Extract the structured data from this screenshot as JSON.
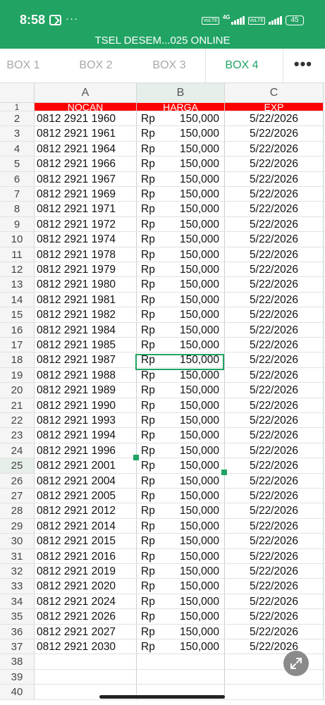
{
  "status_bar": {
    "time": "8:58",
    "more": "···",
    "sig1_tag": "VoLTE",
    "sig_4g": "4G",
    "sig2_tag": "VoLTE",
    "battery": "45"
  },
  "document": {
    "title": "TSEL DESEM...025 ONLINE"
  },
  "tabs": [
    {
      "label": "BOX 1",
      "active": false
    },
    {
      "label": "BOX 2",
      "active": false
    },
    {
      "label": "BOX 3",
      "active": false
    },
    {
      "label": "BOX 4",
      "active": true
    }
  ],
  "tabs_more": "•••",
  "columns": [
    "A",
    "B",
    "C"
  ],
  "header_row": {
    "num": "1",
    "a": "NOCAN",
    "b": "HARGA",
    "c": "EXP"
  },
  "rows": [
    {
      "num": "2",
      "nocan": "0812 2921 1960",
      "currency": "Rp",
      "price": "150,000",
      "exp": "5/22/2026"
    },
    {
      "num": "3",
      "nocan": "0812 2921 1961",
      "currency": "Rp",
      "price": "150,000",
      "exp": "5/22/2026"
    },
    {
      "num": "4",
      "nocan": "0812 2921 1964",
      "currency": "Rp",
      "price": "150,000",
      "exp": "5/22/2026"
    },
    {
      "num": "5",
      "nocan": "0812 2921 1966",
      "currency": "Rp",
      "price": "150,000",
      "exp": "5/22/2026"
    },
    {
      "num": "6",
      "nocan": "0812 2921 1967",
      "currency": "Rp",
      "price": "150,000",
      "exp": "5/22/2026"
    },
    {
      "num": "7",
      "nocan": "0812 2921 1969",
      "currency": "Rp",
      "price": "150,000",
      "exp": "5/22/2026"
    },
    {
      "num": "8",
      "nocan": "0812 2921 1971",
      "currency": "Rp",
      "price": "150,000",
      "exp": "5/22/2026"
    },
    {
      "num": "9",
      "nocan": "0812 2921 1972",
      "currency": "Rp",
      "price": "150,000",
      "exp": "5/22/2026"
    },
    {
      "num": "10",
      "nocan": "0812 2921 1974",
      "currency": "Rp",
      "price": "150,000",
      "exp": "5/22/2026"
    },
    {
      "num": "11",
      "nocan": "0812 2921 1978",
      "currency": "Rp",
      "price": "150,000",
      "exp": "5/22/2026"
    },
    {
      "num": "12",
      "nocan": "0812 2921 1979",
      "currency": "Rp",
      "price": "150,000",
      "exp": "5/22/2026"
    },
    {
      "num": "13",
      "nocan": "0812 2921 1980",
      "currency": "Rp",
      "price": "150,000",
      "exp": "5/22/2026"
    },
    {
      "num": "14",
      "nocan": "0812 2921 1981",
      "currency": "Rp",
      "price": "150,000",
      "exp": "5/22/2026"
    },
    {
      "num": "15",
      "nocan": "0812 2921 1982",
      "currency": "Rp",
      "price": "150,000",
      "exp": "5/22/2026"
    },
    {
      "num": "16",
      "nocan": "0812 2921 1984",
      "currency": "Rp",
      "price": "150,000",
      "exp": "5/22/2026"
    },
    {
      "num": "17",
      "nocan": "0812 2921 1985",
      "currency": "Rp",
      "price": "150,000",
      "exp": "5/22/2026"
    },
    {
      "num": "18",
      "nocan": "0812 2921 1987",
      "currency": "Rp",
      "price": "150,000",
      "exp": "5/22/2026"
    },
    {
      "num": "19",
      "nocan": "0812 2921 1988",
      "currency": "Rp",
      "price": "150,000",
      "exp": "5/22/2026"
    },
    {
      "num": "20",
      "nocan": "0812 2921 1989",
      "currency": "Rp",
      "price": "150,000",
      "exp": "5/22/2026"
    },
    {
      "num": "21",
      "nocan": "0812 2921 1990",
      "currency": "Rp",
      "price": "150,000",
      "exp": "5/22/2026"
    },
    {
      "num": "22",
      "nocan": "0812 2921 1993",
      "currency": "Rp",
      "price": "150,000",
      "exp": "5/22/2026"
    },
    {
      "num": "23",
      "nocan": "0812 2921 1994",
      "currency": "Rp",
      "price": "150,000",
      "exp": "5/22/2026"
    },
    {
      "num": "24",
      "nocan": "0812 2921 1996",
      "currency": "Rp",
      "price": "150,000",
      "exp": "5/22/2026"
    },
    {
      "num": "25",
      "nocan": "0812 2921 2001",
      "currency": "Rp",
      "price": "150,000",
      "exp": "5/22/2026",
      "selected": true
    },
    {
      "num": "26",
      "nocan": "0812 2921 2004",
      "currency": "Rp",
      "price": "150,000",
      "exp": "5/22/2026"
    },
    {
      "num": "27",
      "nocan": "0812 2921 2005",
      "currency": "Rp",
      "price": "150,000",
      "exp": "5/22/2026"
    },
    {
      "num": "28",
      "nocan": "0812 2921 2012",
      "currency": "Rp",
      "price": "150,000",
      "exp": "5/22/2026"
    },
    {
      "num": "29",
      "nocan": "0812 2921 2014",
      "currency": "Rp",
      "price": "150,000",
      "exp": "5/22/2026"
    },
    {
      "num": "30",
      "nocan": "0812 2921 2015",
      "currency": "Rp",
      "price": "150,000",
      "exp": "5/22/2026"
    },
    {
      "num": "31",
      "nocan": "0812 2921 2016",
      "currency": "Rp",
      "price": "150,000",
      "exp": "5/22/2026"
    },
    {
      "num": "32",
      "nocan": "0812 2921 2019",
      "currency": "Rp",
      "price": "150,000",
      "exp": "5/22/2026"
    },
    {
      "num": "33",
      "nocan": "0812 2921 2020",
      "currency": "Rp",
      "price": "150,000",
      "exp": "5/22/2026"
    },
    {
      "num": "34",
      "nocan": "0812 2921 2024",
      "currency": "Rp",
      "price": "150,000",
      "exp": "5/22/2026"
    },
    {
      "num": "35",
      "nocan": "0812 2921 2026",
      "currency": "Rp",
      "price": "150,000",
      "exp": "5/22/2026"
    },
    {
      "num": "36",
      "nocan": "0812 2921 2027",
      "currency": "Rp",
      "price": "150,000",
      "exp": "5/22/2026"
    },
    {
      "num": "37",
      "nocan": "0812 2921 2030",
      "currency": "Rp",
      "price": "150,000",
      "exp": "5/22/2026"
    }
  ],
  "empty_rows": [
    "38",
    "39",
    "40"
  ],
  "selected_cell": "B25",
  "icons": {
    "app": "notification-app-icon",
    "fab": "expand-icon"
  },
  "colors": {
    "brand_green": "#21a363",
    "header_red": "#ff0000",
    "fab_gray": "#8a8a8a"
  }
}
